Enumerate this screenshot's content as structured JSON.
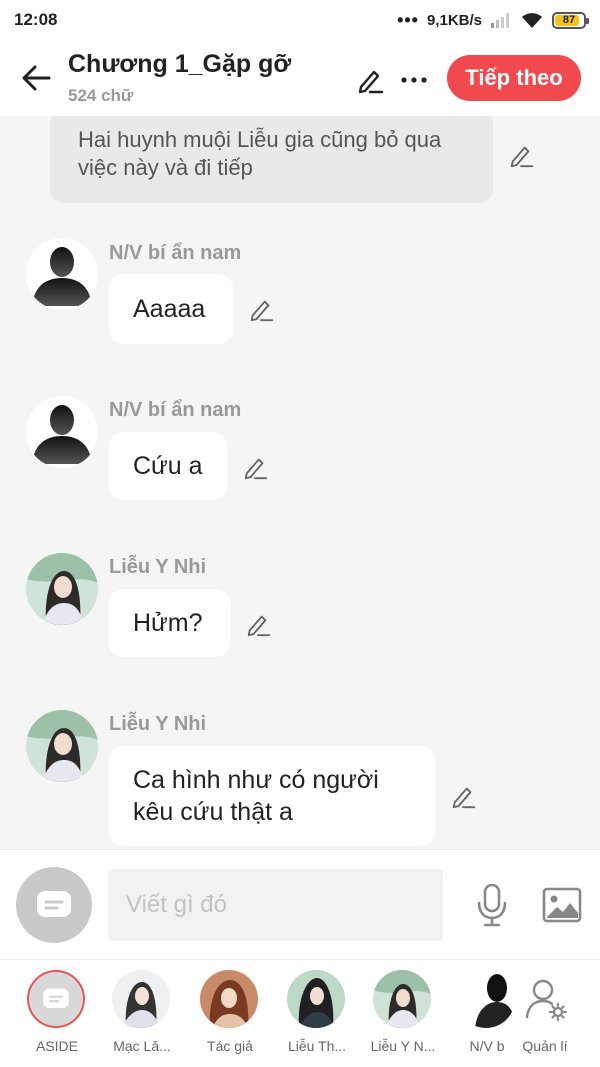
{
  "status_bar": {
    "time": "12:08",
    "network_speed": "9,1KB/s",
    "battery": "87"
  },
  "header": {
    "title": "Chương 1_Gặp gỡ",
    "word_count": "524 chữ",
    "next_label": "Tiếp theo"
  },
  "chat": {
    "narration": "Hai huynh muội Liễu gia cũng bỏ qua việc này và đi tiếp",
    "messages": [
      {
        "sender": "N/V bí ẩn nam",
        "text": "Aaaaa"
      },
      {
        "sender": "N/V bí ẩn nam",
        "text": "Cứu a"
      },
      {
        "sender": "Liễu Y Nhi",
        "text": "Hửm?"
      },
      {
        "sender": "Liễu Y Nhi",
        "text_line1": "Ca hình như có người",
        "text_line2": "kêu cứu thật a"
      }
    ]
  },
  "composer": {
    "placeholder": "Viết gì đó"
  },
  "characters": [
    {
      "label": "ASIDE"
    },
    {
      "label": "Mạc Lă..."
    },
    {
      "label": "Tác giả"
    },
    {
      "label": "Liễu Th..."
    },
    {
      "label": "Liễu Y N..."
    },
    {
      "label": "N/V b"
    },
    {
      "label": "Quản lí"
    }
  ],
  "colors": {
    "accent": "#f04a4f",
    "bubble": "#ffffff",
    "background": "#f5f5f5",
    "narration_bg": "#e9e9e9"
  },
  "icons": [
    "back-arrow-icon",
    "pencil-icon",
    "more-icon",
    "microphone-icon",
    "image-icon",
    "chat-bubble-icon",
    "user-settings-icon",
    "wifi-icon",
    "signal-icon"
  ]
}
